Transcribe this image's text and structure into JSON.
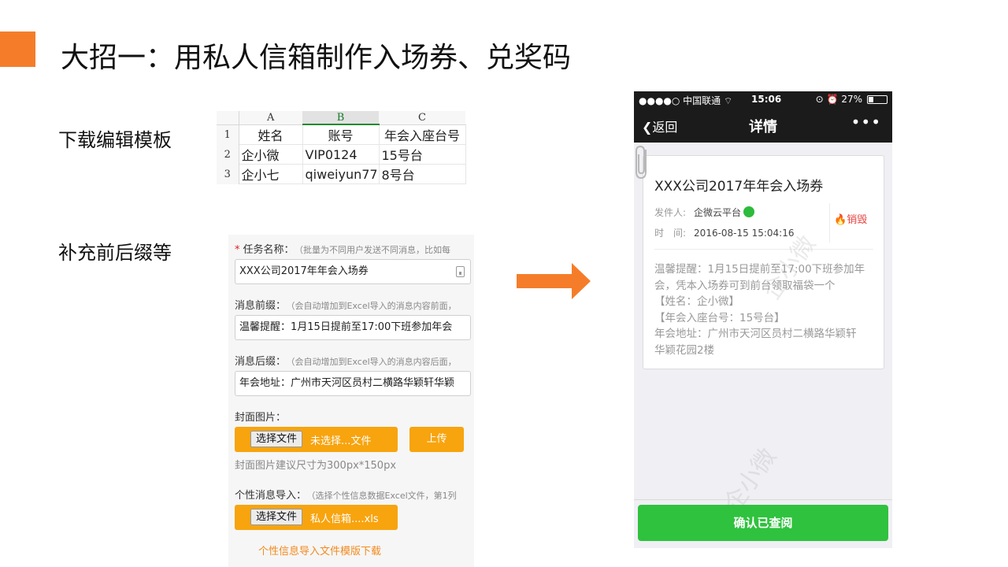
{
  "slide": {
    "title": "大招一：用私人信箱制作入场券、兑奖码",
    "accent_color": "#f57d2a",
    "label_template": "下载编辑模板",
    "label_affix": "补充前后缀等"
  },
  "spreadsheet": {
    "col_headers": [
      "A",
      "B",
      "C"
    ],
    "row_numbers": [
      "1",
      "2",
      "3"
    ],
    "rows": [
      [
        "姓名",
        "账号",
        "年会入座台号"
      ],
      [
        "企小微",
        "VIP0124",
        "15号台"
      ],
      [
        "企小七",
        "qiweiyun77",
        "8号台"
      ]
    ]
  },
  "form": {
    "task_name_label": "任务名称：",
    "task_name_required": "*",
    "task_name_hint": "（批量为不同用户发送不同消息，比如每",
    "task_name_value": "XXX公司2017年年会入场券",
    "prefix_label": "消息前缀：",
    "prefix_hint": "（会自动增加到Excel导入的消息内容前面，",
    "prefix_value": "温馨提醒：1月15日提前至17:00下班参加年会",
    "suffix_label": "消息后缀：",
    "suffix_hint": "（会自动增加到Excel导入的消息内容后面，",
    "suffix_value": "年会地址：广州市天河区员村二横路华颖轩华颖",
    "cover_label": "封面图片：",
    "choose_file": "选择文件",
    "cover_file": "未选择...文件",
    "upload": "上传",
    "cover_size_tip": "封面图片建议尺寸为300px*150px",
    "import_label": "个性消息导入：",
    "import_hint": "（选择个性信息数据Excel文件，第1列",
    "import_file": "私人信箱....xls",
    "template_download": "个性信息导入文件模版下载",
    "button_color": "#f7a40e"
  },
  "phone": {
    "status": {
      "carrier": "●●●●○ 中国联通",
      "time": "15:06",
      "battery": "27%",
      "battery_level": 0.27
    },
    "nav": {
      "back": "返回",
      "title": "详情",
      "more": "•••"
    },
    "card": {
      "title": "XXX公司2017年年会入场券",
      "sender_label": "发件人:",
      "sender": "企微云平台",
      "time_label": "时　间:",
      "time": "2016-08-15 15:04:16",
      "destroy": "销毁",
      "body_lines": [
        "温馨提醒：1月15日提前至17:00下班参加年",
        "会，凭本入场券可到前台领取福袋一个",
        "【姓名：企小微】",
        "【年会入座台号：15号台】",
        "年会地址：广州市天河区员村二横路华颖轩",
        "华颖花园2楼"
      ]
    },
    "watermark": [
      "企小微",
      "企小微"
    ],
    "confirm": "确认已查阅",
    "confirm_color": "#2fc23e"
  }
}
